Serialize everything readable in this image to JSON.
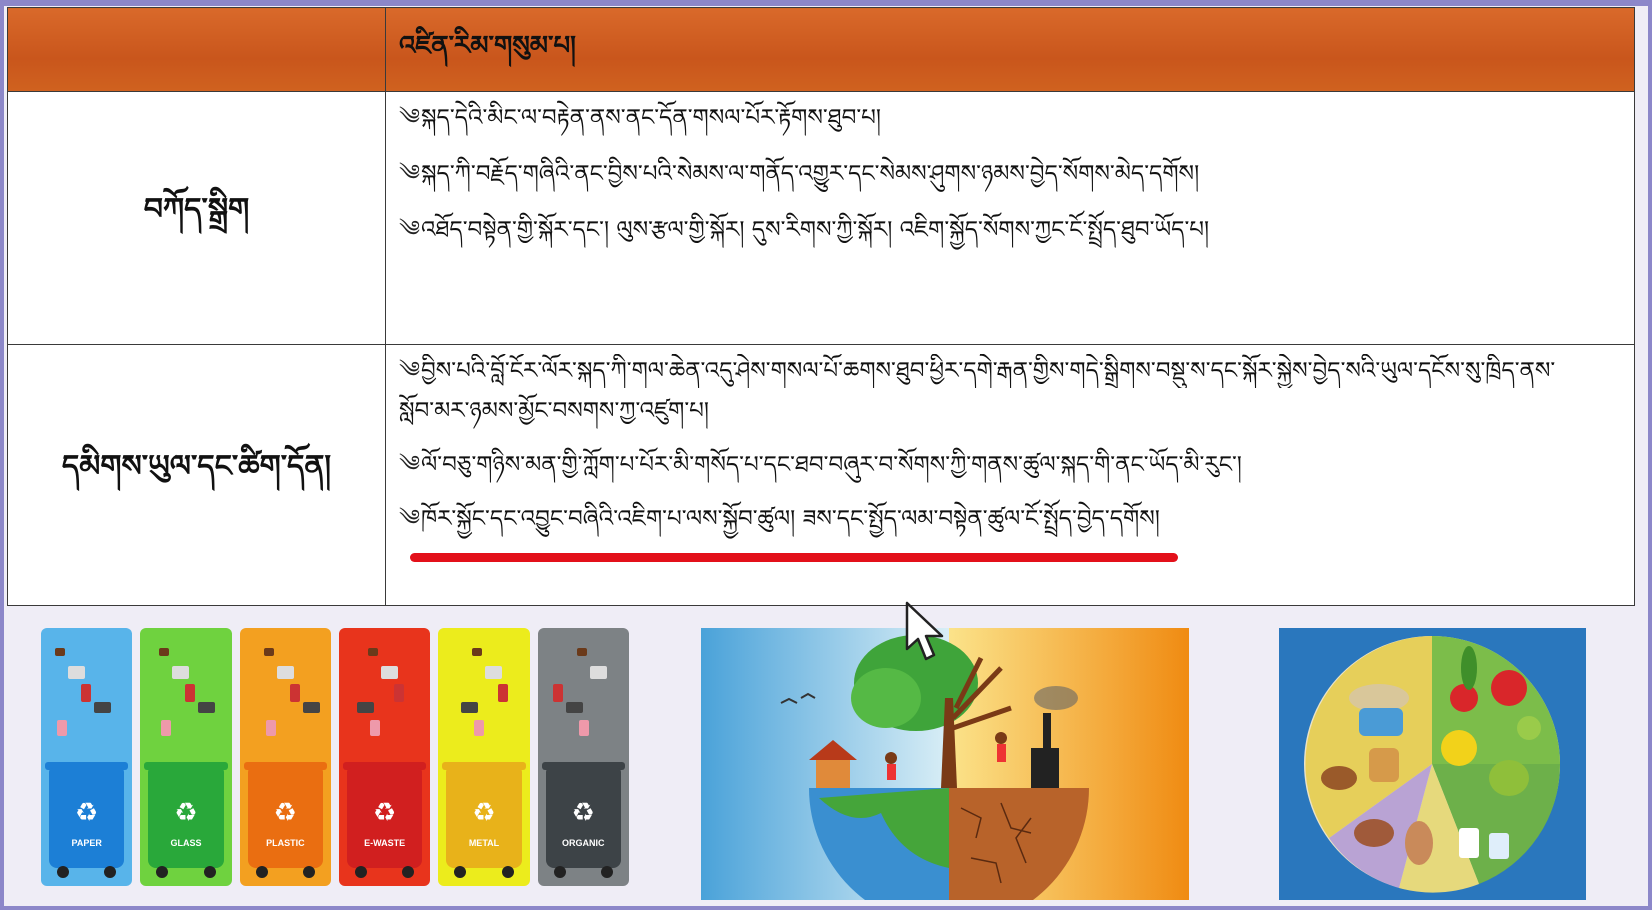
{
  "table": {
    "header_title": "འཛིན་རིམ་གསུམ་པ།",
    "rows": [
      {
        "label": "བཀོད་སྒྲིག",
        "bullets": [
          "སྐད་དེའི་མིང་ལ་བརྟེན་ནས་ནང་དོན་གསལ་པོར་རྟོགས་ཐུབ་པ།",
          "སྐད་ཀི་བརྗོད་གཞིའི་ནང་བྱིས་པའི་སེམས་ལ་གནོད་འགྱུར་དང་སེམས་ཤུགས་ཉམས་བྱེད་སོགས་མེད་དགོས།",
          "འཐོད་བསྟེན་གྱི་སྐོར་དང་། ལུས་རྩལ་གྱི་སྐོར། དུས་རིགས་ཀྱི་སྐོར། འཇིག་སྐྱོད་སོགས་ཀྱང་ངོ་སྤྲོད་ཐུབ་ཡོད་པ།"
        ]
      },
      {
        "label": "དམིགས་ཡུལ་དང་ཚིག་དོན།",
        "bullets": [
          "བྱིས་པའི་བློ་ངོར་ལོར་སྐད་ཀི་གལ་ཆེན་འདུ་ཤེས་གསལ་པོ་ཆགས་ཐུབ་ཕྱིར་དགེ་རྒན་གྱིས་གདེ་སྒྲིགས་བསྡུ་ས་དང་སྐོར་སྐྱེས་བྱེད་སའི་ཡུལ་དངོས་སུ་ཁྲིད་ནས་",
          "སློབ་མར་ཉམས་མྱོང་བསགས་ཀྱ་འཛུག་པ།",
          "ལོ་བཅུ་གཉིས་མན་གྱི་ཀློག་པ་པོར་མི་གསོད་པ་དང་ཐབ་བཞུར་བ་སོགས་ཀྱི་གནས་ཚུལ་སྐད་གི་ནང་ཡོད་མི་རུང་།",
          "ཁོར་སྐྱོང་དང་འབྱུང་བཞིའི་འཇིག་པ་ལས་སྐྱོབ་ཚུལ། ཟས་དང་སྤྱོད་ལམ་བསྟེན་ཚུལ་ངོ་སྤྲོད་བྱེད་དགོས།"
        ]
      }
    ]
  },
  "bullet_marker": "༄",
  "bins": [
    {
      "name": "PAPER",
      "color": "#1c7fd6",
      "bg": "#58b4ea",
      "symbol": "♻"
    },
    {
      "name": "GLASS",
      "color": "#29a83a",
      "bg": "#6fd23f",
      "symbol": "♻"
    },
    {
      "name": "PLASTIC",
      "color": "#ea6e11",
      "bg": "#f3a020",
      "symbol": "♻"
    },
    {
      "name": "E-WASTE",
      "color": "#d11f1f",
      "bg": "#e8341c",
      "symbol": "♻"
    },
    {
      "name": "METAL",
      "color": "#e8b21a",
      "bg": "#ecec1c",
      "symbol": "♻"
    },
    {
      "name": "ORGANIC",
      "color": "#3d4347",
      "bg": "#7d8285",
      "symbol": "♻"
    }
  ]
}
